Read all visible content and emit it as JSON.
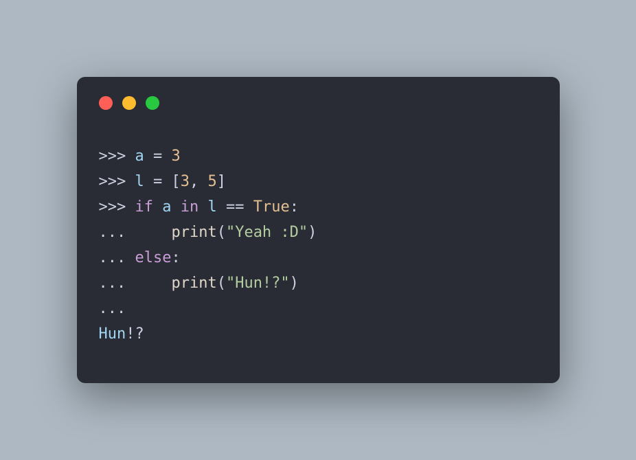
{
  "window": {
    "controls": {
      "close_color": "#ff5f57",
      "minimize_color": "#febc2e",
      "maximize_color": "#28c840"
    }
  },
  "code": {
    "lines": [
      {
        "prompt": ">>> ",
        "tokens": [
          {
            "text": "a",
            "cls": "c-var"
          },
          {
            "text": " = ",
            "cls": "c-op"
          },
          {
            "text": "3",
            "cls": "c-num"
          }
        ]
      },
      {
        "prompt": ">>> ",
        "tokens": [
          {
            "text": "l",
            "cls": "c-var"
          },
          {
            "text": " = [",
            "cls": "c-punct"
          },
          {
            "text": "3",
            "cls": "c-num"
          },
          {
            "text": ", ",
            "cls": "c-punct"
          },
          {
            "text": "5",
            "cls": "c-num"
          },
          {
            "text": "]",
            "cls": "c-punct"
          }
        ]
      },
      {
        "prompt": ">>> ",
        "tokens": [
          {
            "text": "if",
            "cls": "c-keyword"
          },
          {
            "text": " ",
            "cls": "c-op"
          },
          {
            "text": "a",
            "cls": "c-var"
          },
          {
            "text": " ",
            "cls": "c-op"
          },
          {
            "text": "in",
            "cls": "c-keyword"
          },
          {
            "text": " ",
            "cls": "c-op"
          },
          {
            "text": "l",
            "cls": "c-var"
          },
          {
            "text": " == ",
            "cls": "c-op"
          },
          {
            "text": "True",
            "cls": "c-bool"
          },
          {
            "text": ":",
            "cls": "c-punct"
          }
        ]
      },
      {
        "prompt": "... ",
        "tokens": [
          {
            "text": "    ",
            "cls": "c-op"
          },
          {
            "text": "print",
            "cls": "c-func"
          },
          {
            "text": "(",
            "cls": "c-punct"
          },
          {
            "text": "\"Yeah :D\"",
            "cls": "c-string"
          },
          {
            "text": ")",
            "cls": "c-punct"
          }
        ]
      },
      {
        "prompt": "... ",
        "tokens": [
          {
            "text": "else",
            "cls": "c-keyword"
          },
          {
            "text": ":",
            "cls": "c-punct"
          }
        ]
      },
      {
        "prompt": "... ",
        "tokens": [
          {
            "text": "    ",
            "cls": "c-op"
          },
          {
            "text": "print",
            "cls": "c-func"
          },
          {
            "text": "(",
            "cls": "c-punct"
          },
          {
            "text": "\"Hun!?\"",
            "cls": "c-string"
          },
          {
            "text": ")",
            "cls": "c-punct"
          }
        ]
      },
      {
        "prompt": "... ",
        "tokens": []
      }
    ],
    "output": [
      {
        "text": "Hun",
        "cls": "c-output1"
      },
      {
        "text": "!?",
        "cls": "c-output2"
      }
    ]
  }
}
